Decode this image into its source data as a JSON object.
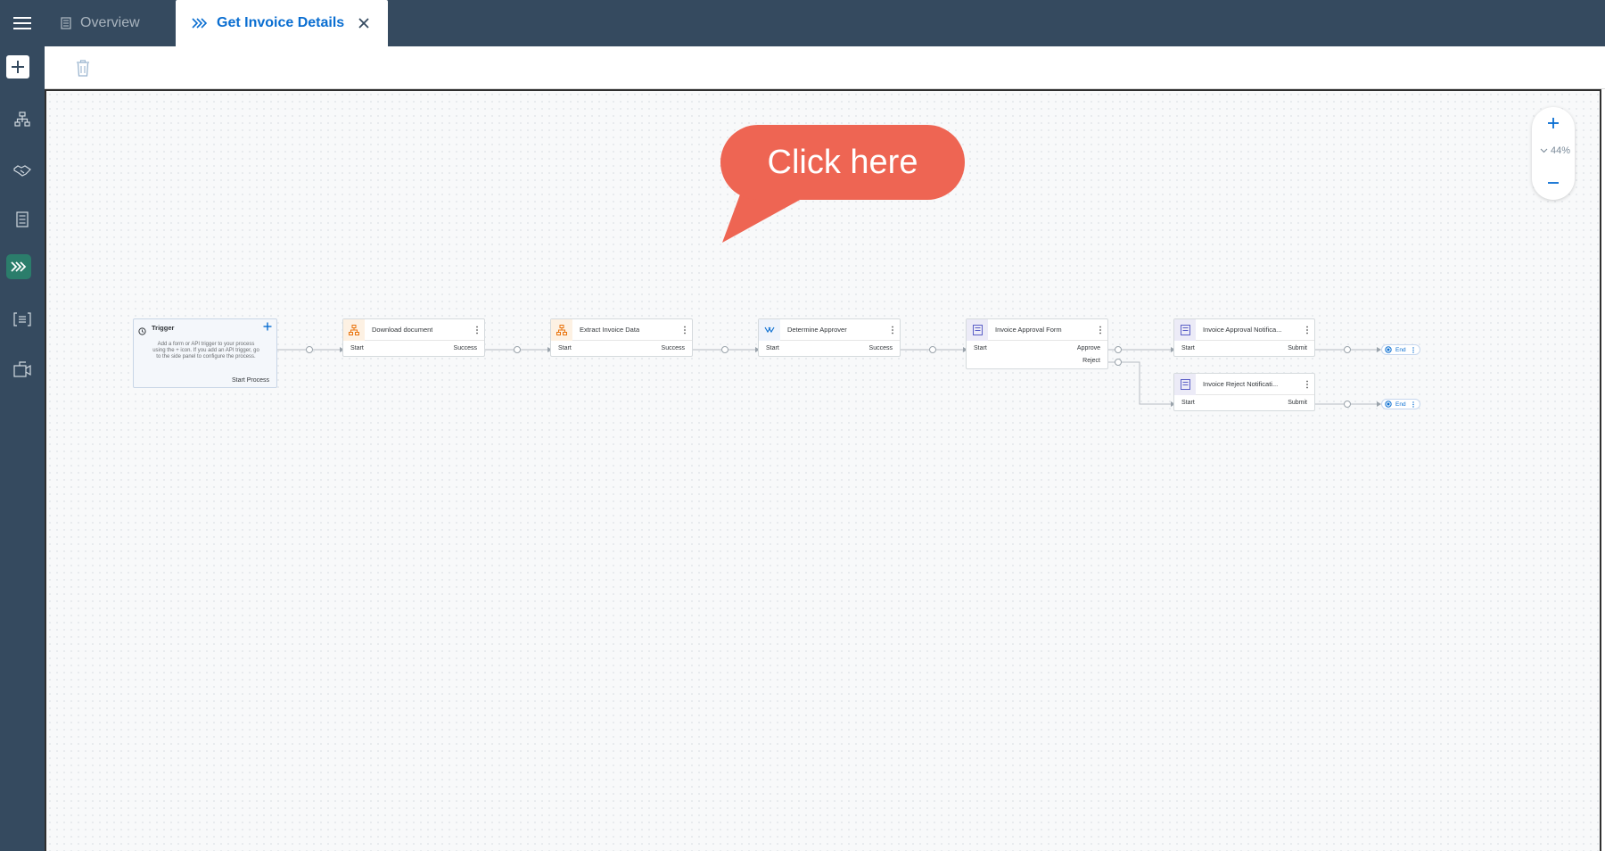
{
  "header": {
    "tabs": [
      {
        "label": "Overview",
        "active": false
      },
      {
        "label": "Get Invoice Details",
        "active": true
      }
    ]
  },
  "zoom": {
    "level": "44%"
  },
  "callout": {
    "text": "Click here"
  },
  "trigger": {
    "title": "Trigger",
    "description": "Add a form or API trigger to your process using the + icon. If you add an API trigger, go to the side panel to configure the process.",
    "output": "Start Process"
  },
  "nodes": [
    {
      "title": "Download document",
      "start": "Start",
      "outputs": [
        "Success"
      ]
    },
    {
      "title": "Extract Invoice Data",
      "start": "Start",
      "outputs": [
        "Success"
      ]
    },
    {
      "title": "Determine Approver",
      "start": "Start",
      "outputs": [
        "Success"
      ]
    },
    {
      "title": "Invoice Approval Form",
      "start": "Start",
      "outputs": [
        "Approve",
        "Reject"
      ]
    },
    {
      "title": "Invoice Approval Notifica...",
      "start": "Start",
      "outputs": [
        "Submit"
      ]
    },
    {
      "title": "Invoice Reject Notificati...",
      "start": "Start",
      "outputs": [
        "Submit"
      ]
    }
  ],
  "ends": [
    {
      "label": "End"
    },
    {
      "label": "End"
    }
  ],
  "icons": {
    "menu": "hamburger-icon",
    "overview": "document-icon",
    "process": "process-chevrons-icon",
    "close": "close-icon",
    "add": "plus-icon",
    "hierarchy": "hierarchy-icon",
    "handshake": "handshake-icon",
    "form": "form-icon",
    "decision": "decision-icon",
    "task_list": "task-list-icon",
    "user_task": "user-task-icon",
    "trash": "trash-icon"
  },
  "colors": {
    "shell": "#354a5f",
    "accent": "#0a6ed1",
    "active_rail": "#2b7d6b",
    "callout": "#ee6553",
    "automation_icon": "#e9730c",
    "form_icon": "#5b5fc7"
  }
}
